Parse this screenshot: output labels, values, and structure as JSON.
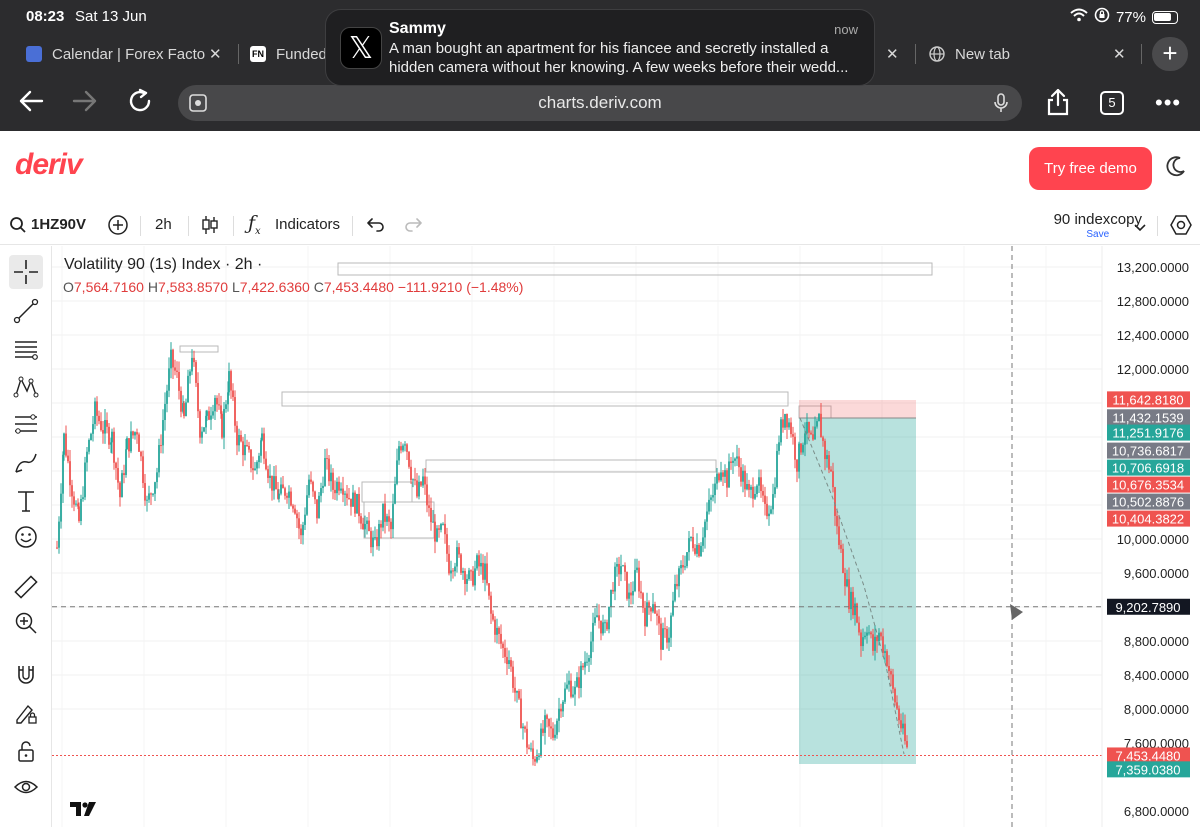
{
  "status_bar": {
    "time": "08:23",
    "date": "Sat 13 Jun",
    "battery": "77%"
  },
  "tabs": [
    {
      "title": "Calendar | Forex Facto",
      "favicon": "FF"
    },
    {
      "title": "Funded",
      "favicon": "FN"
    },
    {
      "title": "New tab",
      "favicon": "globe"
    }
  ],
  "browser": {
    "url": "charts.deriv.com",
    "tab_count": "5"
  },
  "notification": {
    "sender": "Sammy",
    "time": "now",
    "message": "A man bought an apartment for his fiancee and secretly installed a hidden camera without her knowing. A few weeks before their wedd..."
  },
  "header": {
    "logo": "deriv",
    "demo_button": "Try free demo"
  },
  "chart_toolbar": {
    "symbol": "1HZ90V",
    "interval": "2h",
    "indicators": "Indicators",
    "layout_name": "90 indexcopy",
    "save_label": "Save"
  },
  "colors": {
    "up": "#26a69a",
    "down": "#ef5350",
    "brand": "#ff444f"
  },
  "chart_data": {
    "type": "candlestick",
    "title": "Volatility 90 (1s) Index · 2h ·",
    "ohlc": {
      "o_label": "O",
      "o": "7,564.7160",
      "h_label": "H",
      "h": "7,583.8570",
      "l_label": "L",
      "l": "7,422.6360",
      "c_label": "C",
      "c": "7,453.4480",
      "change": "−111.9210 (−1.48%)"
    },
    "ylim": [
      6600,
      13600
    ],
    "y_ticks": [
      "13,200.0000",
      "12,800.0000",
      "12,400.0000",
      "12,000.0000",
      "10,000.0000",
      "9,600.0000",
      "8,800.0000",
      "8,400.0000",
      "8,000.0000",
      "7,600.0000",
      "6,800.0000"
    ],
    "y_tick_values": [
      13200,
      12800,
      12400,
      12000,
      10000,
      9600,
      8800,
      8400,
      8000,
      7600,
      6800
    ],
    "price_labels": [
      {
        "text": "11,642.8180",
        "value": 11642.818,
        "color": "#ef5350"
      },
      {
        "text": "11,432.1539",
        "value": 11432.1539,
        "color": "#787b86"
      },
      {
        "text": "11,251.9176",
        "value": 11251.9176,
        "color": "#26a69a"
      },
      {
        "text": "10,736.6817",
        "value": 11040,
        "color": "#787b86"
      },
      {
        "text": "10,706.6918",
        "value": 10840,
        "color": "#26a69a"
      },
      {
        "text": "10,676.3534",
        "value": 10640,
        "color": "#ef5350"
      },
      {
        "text": "10,502.8876",
        "value": 10440,
        "color": "#787b86"
      },
      {
        "text": "10,404.3822",
        "value": 10240,
        "color": "#ef5350"
      }
    ],
    "crosshair": {
      "text": "9,202.7890",
      "value": 9202.789
    },
    "last_price": {
      "text": "7,453.4480",
      "value": 7453.448
    },
    "target_price": {
      "text": "7,359.0380",
      "value": 7290
    },
    "path": [
      [
        0,
        9900
      ],
      [
        7,
        11200
      ],
      [
        15,
        10600
      ],
      [
        22,
        10200
      ],
      [
        30,
        11000
      ],
      [
        38,
        11500
      ],
      [
        46,
        11300
      ],
      [
        55,
        11200
      ],
      [
        63,
        10500
      ],
      [
        70,
        11100
      ],
      [
        80,
        11300
      ],
      [
        90,
        10400
      ],
      [
        100,
        10800
      ],
      [
        108,
        11600
      ],
      [
        114,
        12100
      ],
      [
        120,
        11900
      ],
      [
        127,
        11400
      ],
      [
        135,
        12200
      ],
      [
        143,
        11300
      ],
      [
        150,
        11400
      ],
      [
        158,
        11700
      ],
      [
        165,
        11300
      ],
      [
        172,
        11900
      ],
      [
        180,
        11200
      ],
      [
        190,
        11000
      ],
      [
        198,
        10800
      ],
      [
        205,
        11200
      ],
      [
        213,
        10700
      ],
      [
        222,
        10500
      ],
      [
        230,
        10600
      ],
      [
        238,
        10400
      ],
      [
        244,
        10000
      ],
      [
        252,
        10700
      ],
      [
        260,
        10300
      ],
      [
        268,
        10900
      ],
      [
        276,
        10600
      ],
      [
        284,
        10700
      ],
      [
        292,
        10500
      ],
      [
        300,
        10400
      ],
      [
        310,
        10100
      ],
      [
        318,
        9900
      ],
      [
        326,
        10300
      ],
      [
        334,
        10100
      ],
      [
        342,
        11100
      ],
      [
        348,
        11200
      ],
      [
        354,
        10800
      ],
      [
        360,
        10500
      ],
      [
        366,
        10700
      ],
      [
        372,
        10300
      ],
      [
        380,
        10000
      ],
      [
        386,
        10100
      ],
      [
        392,
        9700
      ],
      [
        400,
        9800
      ],
      [
        408,
        9600
      ],
      [
        414,
        9500
      ],
      [
        420,
        9700
      ],
      [
        428,
        9600
      ],
      [
        434,
        9100
      ],
      [
        440,
        8900
      ],
      [
        446,
        8700
      ],
      [
        452,
        8600
      ],
      [
        458,
        8200
      ],
      [
        464,
        7900
      ],
      [
        470,
        7600
      ],
      [
        476,
        7400
      ],
      [
        480,
        7500
      ],
      [
        488,
        7800
      ],
      [
        496,
        7700
      ],
      [
        504,
        8100
      ],
      [
        512,
        8300
      ],
      [
        518,
        8200
      ],
      [
        526,
        8500
      ],
      [
        534,
        8800
      ],
      [
        540,
        9100
      ],
      [
        548,
        8900
      ],
      [
        556,
        9500
      ],
      [
        564,
        9700
      ],
      [
        572,
        9300
      ],
      [
        580,
        9600
      ],
      [
        588,
        9100
      ],
      [
        596,
        9300
      ],
      [
        604,
        8800
      ],
      [
        612,
        8900
      ],
      [
        618,
        9400
      ],
      [
        626,
        9700
      ],
      [
        634,
        10000
      ],
      [
        642,
        9900
      ],
      [
        650,
        10300
      ],
      [
        658,
        10600
      ],
      [
        664,
        10900
      ],
      [
        670,
        10700
      ],
      [
        676,
        11000
      ],
      [
        684,
        10800
      ],
      [
        692,
        10500
      ],
      [
        700,
        10700
      ],
      [
        708,
        10300
      ],
      [
        716,
        10500
      ],
      [
        722,
        11200
      ],
      [
        728,
        11500
      ],
      [
        734,
        11300
      ],
      [
        740,
        10900
      ],
      [
        748,
        11300
      ],
      [
        756,
        11100
      ],
      [
        762,
        11400
      ],
      [
        768,
        11000
      ],
      [
        774,
        10800
      ],
      [
        780,
        10100
      ],
      [
        786,
        9700
      ],
      [
        792,
        9300
      ],
      [
        798,
        9200
      ],
      [
        804,
        8800
      ],
      [
        810,
        9000
      ],
      [
        816,
        8700
      ],
      [
        822,
        8900
      ],
      [
        830,
        8600
      ],
      [
        836,
        8200
      ],
      [
        842,
        7900
      ],
      [
        848,
        7600
      ],
      [
        852,
        7450
      ]
    ]
  }
}
